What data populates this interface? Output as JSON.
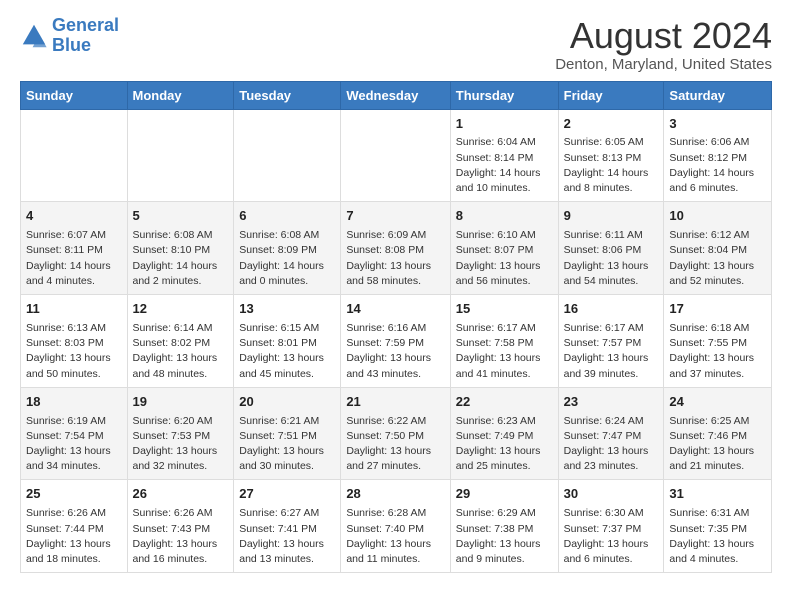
{
  "logo": {
    "line1": "General",
    "line2": "Blue"
  },
  "title": "August 2024",
  "subtitle": "Denton, Maryland, United States",
  "days_of_week": [
    "Sunday",
    "Monday",
    "Tuesday",
    "Wednesday",
    "Thursday",
    "Friday",
    "Saturday"
  ],
  "weeks": [
    [
      {
        "day": "",
        "info": ""
      },
      {
        "day": "",
        "info": ""
      },
      {
        "day": "",
        "info": ""
      },
      {
        "day": "",
        "info": ""
      },
      {
        "day": "1",
        "info": "Sunrise: 6:04 AM\nSunset: 8:14 PM\nDaylight: 14 hours\nand 10 minutes."
      },
      {
        "day": "2",
        "info": "Sunrise: 6:05 AM\nSunset: 8:13 PM\nDaylight: 14 hours\nand 8 minutes."
      },
      {
        "day": "3",
        "info": "Sunrise: 6:06 AM\nSunset: 8:12 PM\nDaylight: 14 hours\nand 6 minutes."
      }
    ],
    [
      {
        "day": "4",
        "info": "Sunrise: 6:07 AM\nSunset: 8:11 PM\nDaylight: 14 hours\nand 4 minutes."
      },
      {
        "day": "5",
        "info": "Sunrise: 6:08 AM\nSunset: 8:10 PM\nDaylight: 14 hours\nand 2 minutes."
      },
      {
        "day": "6",
        "info": "Sunrise: 6:08 AM\nSunset: 8:09 PM\nDaylight: 14 hours\nand 0 minutes."
      },
      {
        "day": "7",
        "info": "Sunrise: 6:09 AM\nSunset: 8:08 PM\nDaylight: 13 hours\nand 58 minutes."
      },
      {
        "day": "8",
        "info": "Sunrise: 6:10 AM\nSunset: 8:07 PM\nDaylight: 13 hours\nand 56 minutes."
      },
      {
        "day": "9",
        "info": "Sunrise: 6:11 AM\nSunset: 8:06 PM\nDaylight: 13 hours\nand 54 minutes."
      },
      {
        "day": "10",
        "info": "Sunrise: 6:12 AM\nSunset: 8:04 PM\nDaylight: 13 hours\nand 52 minutes."
      }
    ],
    [
      {
        "day": "11",
        "info": "Sunrise: 6:13 AM\nSunset: 8:03 PM\nDaylight: 13 hours\nand 50 minutes."
      },
      {
        "day": "12",
        "info": "Sunrise: 6:14 AM\nSunset: 8:02 PM\nDaylight: 13 hours\nand 48 minutes."
      },
      {
        "day": "13",
        "info": "Sunrise: 6:15 AM\nSunset: 8:01 PM\nDaylight: 13 hours\nand 45 minutes."
      },
      {
        "day": "14",
        "info": "Sunrise: 6:16 AM\nSunset: 7:59 PM\nDaylight: 13 hours\nand 43 minutes."
      },
      {
        "day": "15",
        "info": "Sunrise: 6:17 AM\nSunset: 7:58 PM\nDaylight: 13 hours\nand 41 minutes."
      },
      {
        "day": "16",
        "info": "Sunrise: 6:17 AM\nSunset: 7:57 PM\nDaylight: 13 hours\nand 39 minutes."
      },
      {
        "day": "17",
        "info": "Sunrise: 6:18 AM\nSunset: 7:55 PM\nDaylight: 13 hours\nand 37 minutes."
      }
    ],
    [
      {
        "day": "18",
        "info": "Sunrise: 6:19 AM\nSunset: 7:54 PM\nDaylight: 13 hours\nand 34 minutes."
      },
      {
        "day": "19",
        "info": "Sunrise: 6:20 AM\nSunset: 7:53 PM\nDaylight: 13 hours\nand 32 minutes."
      },
      {
        "day": "20",
        "info": "Sunrise: 6:21 AM\nSunset: 7:51 PM\nDaylight: 13 hours\nand 30 minutes."
      },
      {
        "day": "21",
        "info": "Sunrise: 6:22 AM\nSunset: 7:50 PM\nDaylight: 13 hours\nand 27 minutes."
      },
      {
        "day": "22",
        "info": "Sunrise: 6:23 AM\nSunset: 7:49 PM\nDaylight: 13 hours\nand 25 minutes."
      },
      {
        "day": "23",
        "info": "Sunrise: 6:24 AM\nSunset: 7:47 PM\nDaylight: 13 hours\nand 23 minutes."
      },
      {
        "day": "24",
        "info": "Sunrise: 6:25 AM\nSunset: 7:46 PM\nDaylight: 13 hours\nand 21 minutes."
      }
    ],
    [
      {
        "day": "25",
        "info": "Sunrise: 6:26 AM\nSunset: 7:44 PM\nDaylight: 13 hours\nand 18 minutes."
      },
      {
        "day": "26",
        "info": "Sunrise: 6:26 AM\nSunset: 7:43 PM\nDaylight: 13 hours\nand 16 minutes."
      },
      {
        "day": "27",
        "info": "Sunrise: 6:27 AM\nSunset: 7:41 PM\nDaylight: 13 hours\nand 13 minutes."
      },
      {
        "day": "28",
        "info": "Sunrise: 6:28 AM\nSunset: 7:40 PM\nDaylight: 13 hours\nand 11 minutes."
      },
      {
        "day": "29",
        "info": "Sunrise: 6:29 AM\nSunset: 7:38 PM\nDaylight: 13 hours\nand 9 minutes."
      },
      {
        "day": "30",
        "info": "Sunrise: 6:30 AM\nSunset: 7:37 PM\nDaylight: 13 hours\nand 6 minutes."
      },
      {
        "day": "31",
        "info": "Sunrise: 6:31 AM\nSunset: 7:35 PM\nDaylight: 13 hours\nand 4 minutes."
      }
    ]
  ]
}
